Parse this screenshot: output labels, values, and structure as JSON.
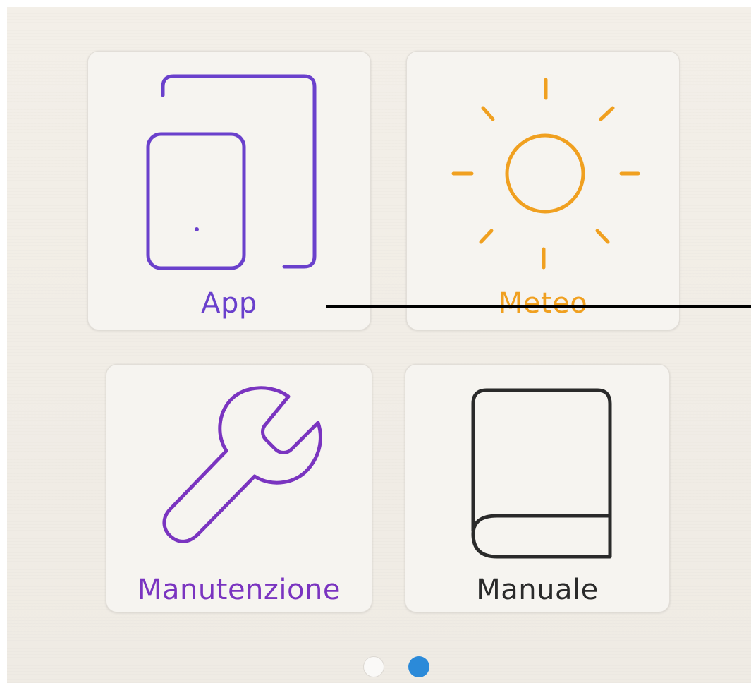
{
  "tiles": [
    {
      "label": "App",
      "icon": "app-window-icon",
      "color": "#6a40cc"
    },
    {
      "label": "Meteo",
      "icon": "sun-icon",
      "color": "#f0a020"
    },
    {
      "label": "Manutenzione",
      "icon": "wrench-icon",
      "color": "#7a34c0"
    },
    {
      "label": "Manuale",
      "icon": "book-icon",
      "color": "#2a2a2a"
    }
  ],
  "pager": {
    "page_count": 2,
    "active_page": 2,
    "active_color": "#2b8ad9",
    "inactive_color": "#faf9f7"
  }
}
